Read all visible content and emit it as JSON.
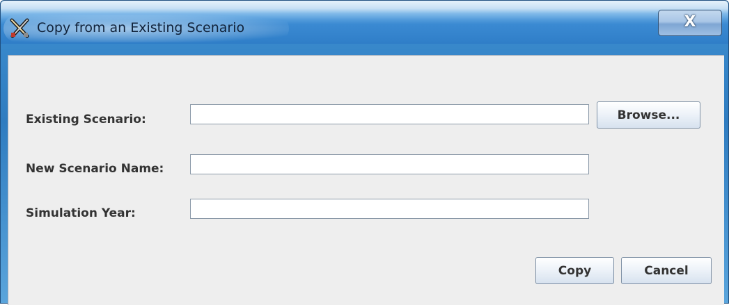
{
  "window": {
    "title": "Copy from an Existing Scenario",
    "close_label": "X"
  },
  "form": {
    "existing_scenario": {
      "label": "Existing Scenario:",
      "value": "",
      "browse_label": "Browse..."
    },
    "new_scenario_name": {
      "label": "New Scenario Name:",
      "value": ""
    },
    "simulation_year": {
      "label": "Simulation Year:",
      "value": ""
    }
  },
  "buttons": {
    "copy_label": "Copy",
    "cancel_label": "Cancel"
  },
  "icons": {
    "app": "tools-x-icon",
    "close": "close-icon"
  },
  "colors": {
    "titlebar": "#3b8ad2",
    "client_background": "#eeeeee",
    "label_text": "#333333"
  }
}
